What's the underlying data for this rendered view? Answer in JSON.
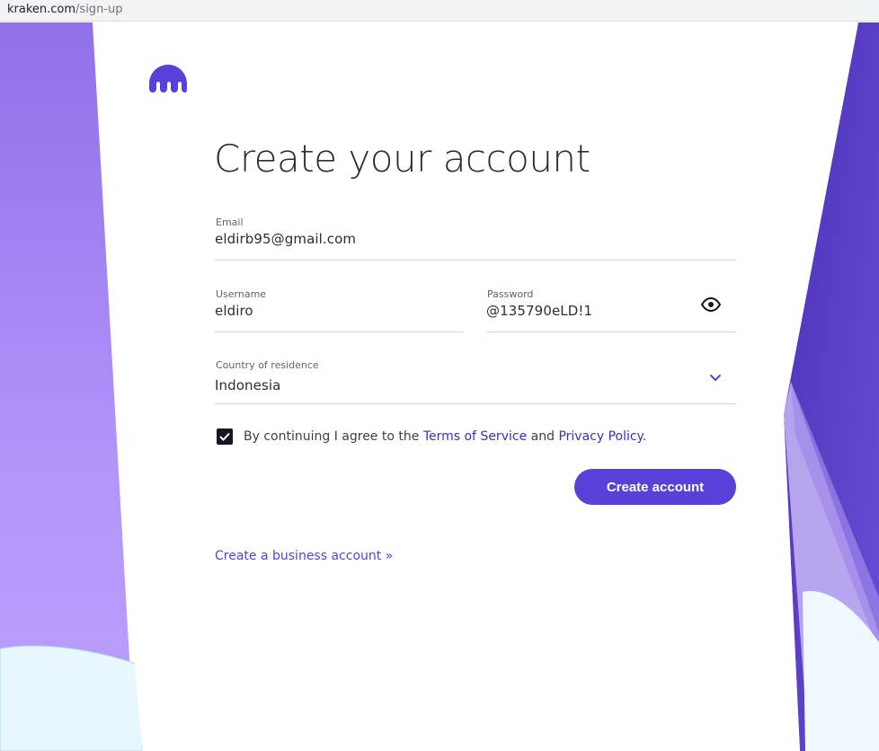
{
  "browser": {
    "url_host": "kraken.com",
    "url_path": "/sign-up"
  },
  "page": {
    "title": "Create your account",
    "email": {
      "label": "Email",
      "value": "eldirb95@gmail.com"
    },
    "username": {
      "label": "Username",
      "value": "eldiro"
    },
    "password": {
      "label": "Password",
      "value": "@135790eLD!1"
    },
    "country": {
      "label": "Country of residence",
      "value": "Indonesia"
    },
    "agreement": {
      "prefix": "By continuing I agree to the ",
      "terms_link": "Terms of Service",
      "middle": " and ",
      "privacy_link": "Privacy Policy.",
      "checked": true
    },
    "create_button": "Create account",
    "business_link": "Create a business account »"
  },
  "colors": {
    "brand": "#5741d9",
    "link_dark": "#3b2fb3",
    "background_purple": "#9b7ff0",
    "background_ice": "#e8f7fd"
  },
  "icons": [
    "kraken-logo-icon",
    "eye-icon",
    "chevron-down-icon",
    "checkmark-icon"
  ]
}
